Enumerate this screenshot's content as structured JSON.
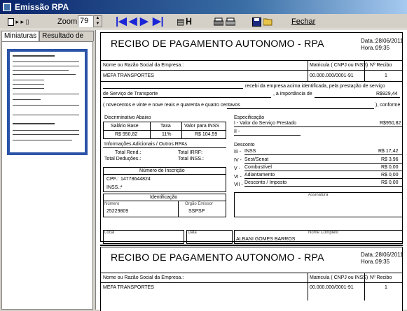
{
  "window": {
    "title": "Emissão RPA"
  },
  "toolbar": {
    "zoom_label": "Zoom:",
    "zoom_value": "79",
    "close_label": "Fechar"
  },
  "tabs": [
    "Miniaturas",
    "Resultado de busca"
  ],
  "receipt": {
    "title": "RECIBO DE PAGAMENTO AUTONOMO - RPA",
    "date_label": "Data.:",
    "date": "28/06/2011",
    "time_label": "Hora.:",
    "time": "09:35",
    "name_header": "Nome ou Razão Social da Empresa.:",
    "cnpj_header": "Matricula ( CNPJ ou INSS)",
    "receipt_no_header": "Nº Recibo",
    "company": "MEFA TRANSPORTES",
    "cnpj": "00.000.000/0001-91",
    "receipt_no": "1",
    "received_text": "recebi da empresa acima identificada, pela prestação de serviço",
    "service": "de Serviço de Transporte",
    "amount_text": ", a importância de",
    "amount": "R$929,44",
    "amount_words": "( novecentos e vinte e nove reais e quarenta e quatro centavos",
    "conforme": "), conforme",
    "discriminative_title": "Discriminativo Abaixo",
    "col_base": "Salário Base",
    "col_taxa": "Taxa",
    "col_valor": "Valor para INSS",
    "base": "R$ 950,82",
    "taxa": "11%",
    "valor": "R$ 104,59",
    "info_title": "Informações Adicionais / Outros RPAs",
    "total_rend": "Total Rend.:",
    "total_irrf": "Total IRRF:",
    "total_ded": "Total Deduções.:",
    "total_inss": "Total INSS.:",
    "inscription_title": "Número de Inscrição",
    "cpf_label": "CPF.:",
    "cpf": "14778644824",
    "inss_label": "INSS.:",
    "inss": "*",
    "ident_title": "Identificação",
    "numero_label": "Número",
    "orgao_label": "Orgão Emissor",
    "numero": "25229809",
    "orgao": "SSPSP",
    "spec_title": "Especificação",
    "spec1": "I - Valor do Serviço Prestado",
    "spec1_value": "R$950,82",
    "spec2": "II -",
    "desc_title": "Desconto",
    "desc": [
      {
        "n": "III -",
        "label": "INSS",
        "value": "R$ 17,42"
      },
      {
        "n": "IV -",
        "label": "Sest/Senat",
        "value": "R$ 3,96"
      },
      {
        "n": "V -",
        "label": "Combustível",
        "value": "R$ 0,00"
      },
      {
        "n": "VI -",
        "label": "Adiantamento",
        "value": "R$ 0,00"
      },
      {
        "n": "VII -",
        "label": "Desconto / Imposto",
        "value": "R$ 0,00"
      }
    ],
    "assinatura_label": "Assinatura",
    "local_label": "Local",
    "data_label": "Data",
    "nome_label": "Nome Completo",
    "nome": "ALBANI GOMES BARROS"
  },
  "colors": {
    "titlebar": "#0a246a",
    "arrows": "#1a25d6",
    "thumb_border": "#2b53a8"
  },
  "icons": [
    "app-icon",
    "page-layout-icon",
    "first-page-icon",
    "previous-page-icon",
    "next-page-icon",
    "last-page-icon",
    "find-icon",
    "print-icon",
    "printer-setup-icon",
    "save-icon",
    "open-folder-icon"
  ]
}
